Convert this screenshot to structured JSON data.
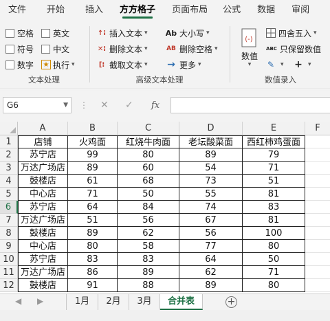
{
  "tabs": [
    "文件",
    "开始",
    "插入",
    "方方格子",
    "页面布局",
    "公式",
    "数据",
    "审阅"
  ],
  "active_tab": "方方格子",
  "ribbon": {
    "text_group": {
      "label": "文本处理",
      "options": [
        "空格",
        "英文",
        "符号",
        "中文",
        "数字"
      ],
      "execute_label": "执行"
    },
    "advanced_group": {
      "label": "高级文本处理",
      "insert_text": "插入文本",
      "delete_text": "删除文本",
      "cut_text": "截取文本",
      "case_label": "大小写",
      "case_icon_text": "Ab",
      "delete_space": "删除空格",
      "delete_space_icon_text": "AB",
      "more": "更多"
    },
    "data_group": {
      "label": "数值录入",
      "value_label": "数值",
      "round_label": "四舍五入",
      "keep_value": "只保留数值",
      "keep_value_icon_text": "ABC"
    }
  },
  "formula_bar": {
    "name_box": "G6",
    "fx_icon_text": "fx",
    "formula": ""
  },
  "columns": [
    "A",
    "B",
    "C",
    "D",
    "E",
    "F"
  ],
  "rows": [
    {
      "n": "1",
      "cells": [
        "店铺",
        "火鸡面",
        "红烧牛肉面",
        "老坛酸菜面",
        "西红柿鸡蛋面"
      ]
    },
    {
      "n": "2",
      "cells": [
        "苏宁店",
        "99",
        "80",
        "89",
        "79"
      ]
    },
    {
      "n": "3",
      "cells": [
        "万达广场店",
        "89",
        "60",
        "54",
        "71"
      ]
    },
    {
      "n": "4",
      "cells": [
        "鼓楼店",
        "61",
        "68",
        "73",
        "51"
      ]
    },
    {
      "n": "5",
      "cells": [
        "中心店",
        "71",
        "50",
        "55",
        "81"
      ]
    },
    {
      "n": "6",
      "cells": [
        "苏宁店",
        "64",
        "84",
        "74",
        "83"
      ]
    },
    {
      "n": "7",
      "cells": [
        "万达广场店",
        "51",
        "56",
        "67",
        "81"
      ]
    },
    {
      "n": "8",
      "cells": [
        "鼓楼店",
        "89",
        "62",
        "56",
        "100"
      ]
    },
    {
      "n": "9",
      "cells": [
        "中心店",
        "80",
        "58",
        "77",
        "80"
      ]
    },
    {
      "n": "10",
      "cells": [
        "苏宁店",
        "83",
        "83",
        "64",
        "50"
      ]
    },
    {
      "n": "11",
      "cells": [
        "万达广场店",
        "86",
        "89",
        "62",
        "71"
      ]
    },
    {
      "n": "12",
      "cells": [
        "鼓楼店",
        "91",
        "88",
        "89",
        "80"
      ]
    }
  ],
  "selected_row": "6",
  "sheets": [
    "1月",
    "2月",
    "3月",
    "合并表"
  ],
  "active_sheet": "合并表",
  "colors": {
    "accent": "#1e7145",
    "ribbon_bg": "#f3f3f3",
    "icon_red": "#c0392b",
    "icon_blue": "#2b6cb0"
  }
}
